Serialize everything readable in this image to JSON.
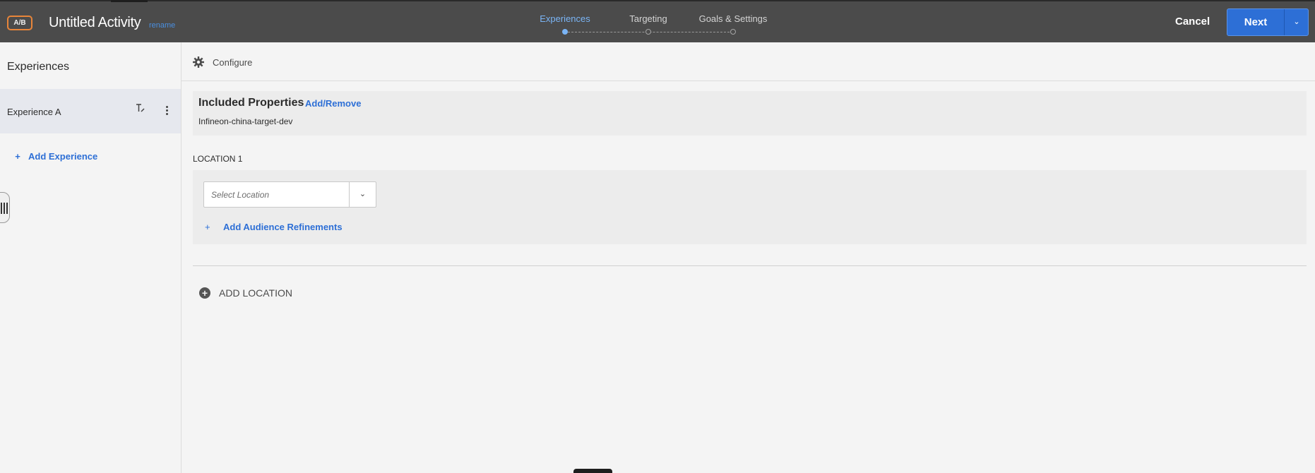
{
  "header": {
    "badge": "A/B",
    "title": "Untitled Activity",
    "rename_label": "rename",
    "steps": [
      {
        "label": "Experiences",
        "active": true
      },
      {
        "label": "Targeting",
        "active": false
      },
      {
        "label": "Goals & Settings",
        "active": false
      }
    ],
    "cancel_label": "Cancel",
    "next_label": "Next",
    "accent_color": "#2d6fd6",
    "badge_color": "#e8853a"
  },
  "sidebar": {
    "title": "Experiences",
    "experiences": [
      {
        "name": "Experience A",
        "selected": true
      }
    ],
    "add_label": "Add Experience",
    "icons": [
      "edit-name-icon",
      "more-options-icon",
      "plus-icon"
    ]
  },
  "main": {
    "configure_label": "Configure",
    "properties": {
      "title": "Included Properties",
      "link_label": "Add/Remove",
      "value": "Infineon-china-target-dev"
    },
    "location": {
      "label": "LOCATION 1",
      "select_placeholder": "Select Location",
      "refine_label": "Add Audience Refinements"
    },
    "add_location_label": "ADD LOCATION"
  }
}
